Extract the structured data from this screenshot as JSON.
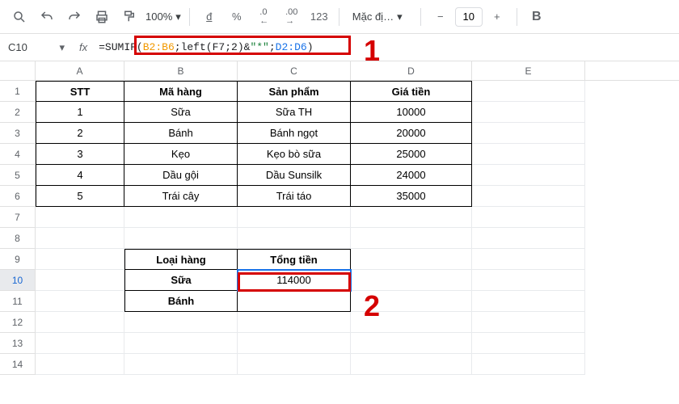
{
  "toolbar": {
    "zoom": "100%",
    "font": "Mặc đị…",
    "font_size": "10"
  },
  "name_box": "C10",
  "formula": {
    "prefix": "=SUMIF(",
    "r1": "B2:B6",
    "s1": ";",
    "fnc": "left",
    "p1": "(",
    "arg": "F7",
    "s2": ";",
    "num": "2",
    "p2": ")",
    "amp": "&",
    "q1": "\"*\"",
    "s3": ";",
    "r2": "D2:D6",
    "suffix": ")"
  },
  "columns": [
    "A",
    "B",
    "C",
    "D",
    "E"
  ],
  "rows": [
    "1",
    "2",
    "3",
    "4",
    "5",
    "6",
    "7",
    "8",
    "9",
    "10",
    "11",
    "12",
    "13",
    "14"
  ],
  "table": {
    "h_stt": "STT",
    "h_ma": "Mã hàng",
    "h_sp": "Sản phẩm",
    "h_gia": "Giá tiền",
    "r1_a": "1",
    "r1_b": "Sữa",
    "r1_c": "Sữa TH",
    "r1_d": "10000",
    "r2_a": "2",
    "r2_b": "Bánh",
    "r2_c": "Bánh ngọt",
    "r2_d": "20000",
    "r3_a": "3",
    "r3_b": "Kẹo",
    "r3_c": "Kẹo bò sữa",
    "r3_d": "25000",
    "r4_a": "4",
    "r4_b": "Dầu gội",
    "r4_c": "Dầu Sunsilk",
    "r4_d": "24000",
    "r5_a": "5",
    "r5_b": "Trái cây",
    "r5_c": "Trái táo",
    "r5_d": "35000"
  },
  "summary": {
    "h_loai": "Loại hàng",
    "h_tong": "Tổng tiền",
    "r1_b": "Sữa",
    "r1_c": "114000",
    "r2_b": "Bánh"
  },
  "annot": {
    "one": "1",
    "two": "2"
  }
}
